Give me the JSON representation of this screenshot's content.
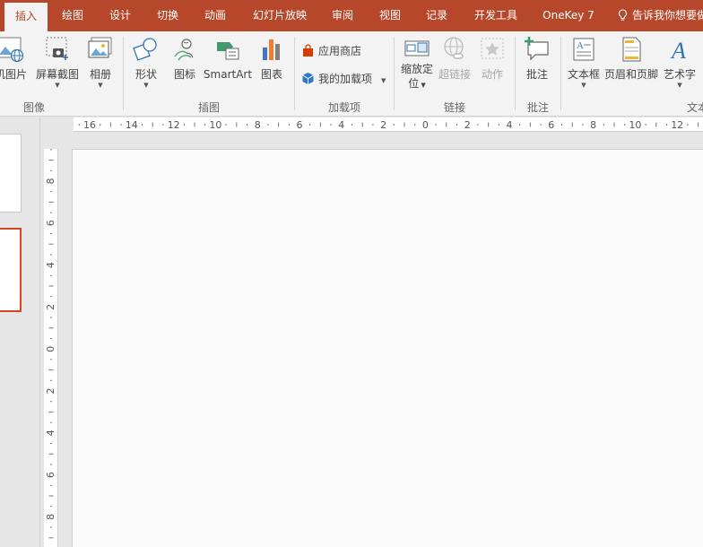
{
  "tabs": [
    "插入",
    "绘图",
    "设计",
    "切换",
    "动画",
    "幻灯片放映",
    "审阅",
    "视图",
    "记录",
    "开发工具",
    "OneKey 7"
  ],
  "tell_me": "告诉我你想要做什么",
  "ribbon": {
    "images": {
      "online_pictures": "机图片",
      "screenshot": "屏幕截图",
      "album": "相册",
      "group": "图像"
    },
    "illustrations": {
      "shapes": "形状",
      "icons": "图标",
      "smartart": "SmartArt",
      "chart": "图表",
      "group": "插图"
    },
    "addins": {
      "store": "应用商店",
      "my_addins": "我的加载项",
      "group": "加载项"
    },
    "links": {
      "zoom_line1": "缩放定",
      "zoom_line2": "位",
      "hyperlink": "超链接",
      "action": "动作",
      "group": "链接"
    },
    "comments": {
      "comment": "批注",
      "group": "批注"
    },
    "text": {
      "textbox": "文本框",
      "header_footer": "页眉和页脚",
      "wordart": "艺术字",
      "group": "文本"
    }
  },
  "rulers": {
    "horizontal_labels": [
      "16",
      "14",
      "12",
      "10",
      "8",
      "6",
      "4",
      "2",
      "0",
      "2",
      "4",
      "6",
      "8",
      "10",
      "12"
    ],
    "vertical_labels": [
      "8",
      "6",
      "4",
      "2",
      "0",
      "2",
      "4",
      "6",
      "8"
    ]
  },
  "colors": {
    "accent": "#b7472a",
    "selected_thumb": "#d24726",
    "ribbon_bg": "#f3f3f3"
  }
}
